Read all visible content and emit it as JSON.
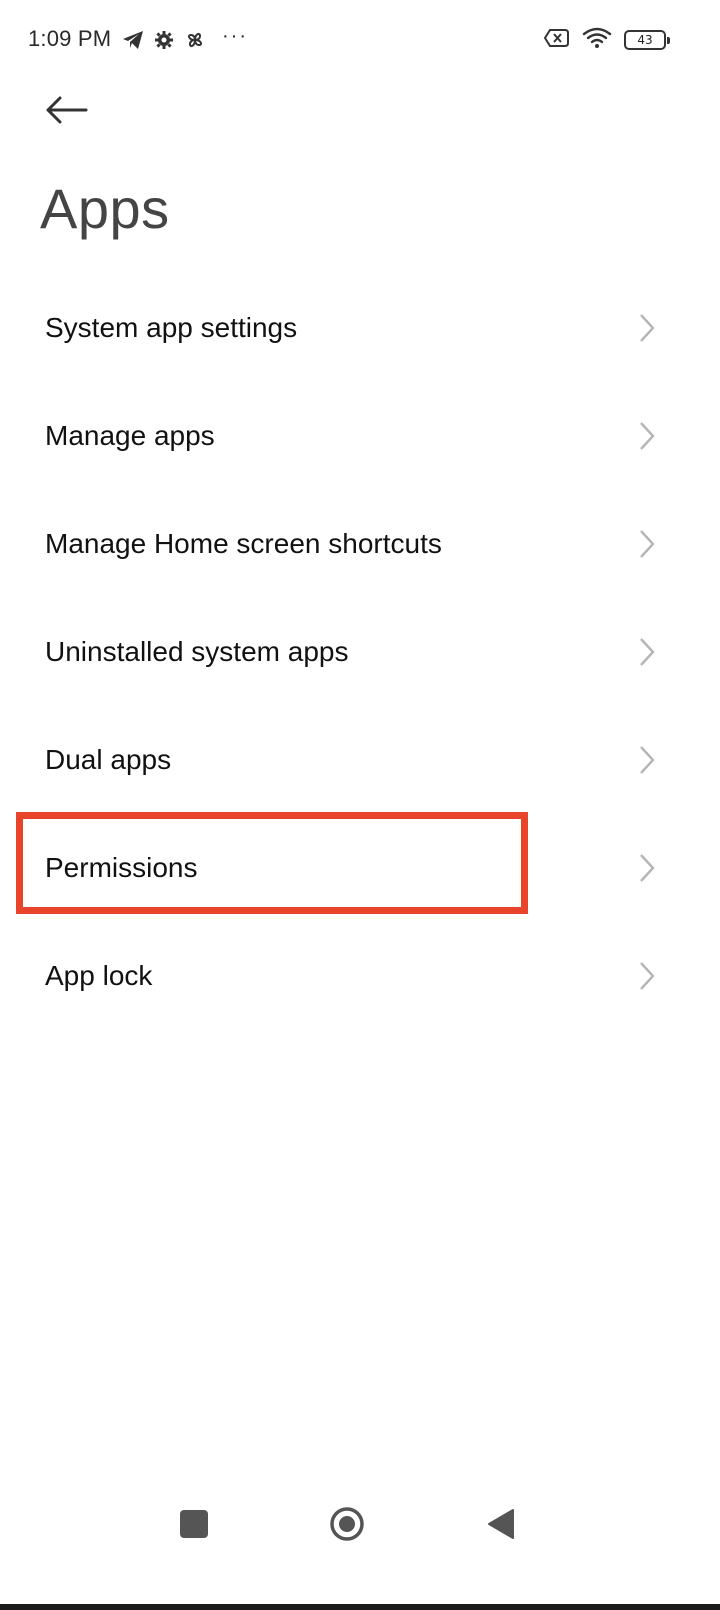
{
  "status_bar": {
    "time": "1:09 PM",
    "left_icons": [
      "telegram-icon",
      "gear-icon",
      "pinwheel-icon",
      "more-dots-icon"
    ],
    "more": "···",
    "right_icons": [
      "sim-no-signal-icon",
      "wifi-icon",
      "battery-icon"
    ],
    "battery_level": "43"
  },
  "header": {
    "back_icon": "arrow-left-icon",
    "title": "Apps"
  },
  "settings_items": [
    {
      "label": "System app settings",
      "icon": "chevron-right-icon"
    },
    {
      "label": "Manage apps",
      "icon": "chevron-right-icon"
    },
    {
      "label": "Manage Home screen shortcuts",
      "icon": "chevron-right-icon"
    },
    {
      "label": "Uninstalled system apps",
      "icon": "chevron-right-icon"
    },
    {
      "label": "Dual apps",
      "icon": "chevron-right-icon"
    },
    {
      "label": "Permissions",
      "icon": "chevron-right-icon",
      "highlighted": true
    },
    {
      "label": "App lock",
      "icon": "chevron-right-icon"
    }
  ],
  "highlight_color": "#e8432b",
  "nav_bar": {
    "buttons": [
      "recents-button",
      "home-button",
      "back-button"
    ]
  }
}
